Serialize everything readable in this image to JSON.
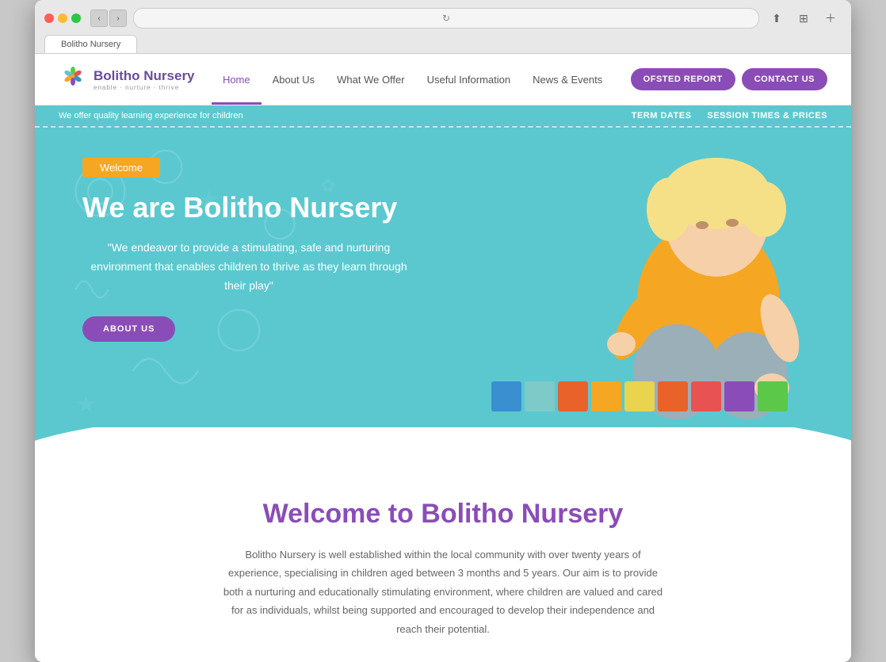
{
  "browser": {
    "tab_label": "Bolitho Nursery"
  },
  "header": {
    "logo_name": "Bolitho Nursery",
    "logo_tagline": "enable · nurture · thrive",
    "nav_items": [
      {
        "label": "Home",
        "active": true
      },
      {
        "label": "About Us",
        "active": false
      },
      {
        "label": "What We Offer",
        "active": false
      },
      {
        "label": "Useful Information",
        "active": false
      },
      {
        "label": "News & Events",
        "active": false
      }
    ],
    "btn_ofsted": "OFSTED REPORT",
    "btn_contact": "CONTACT US"
  },
  "info_bar": {
    "text": "We offer quality learning experience for children",
    "links": [
      "TERM DATES",
      "SESSION TIMES & PRICES"
    ]
  },
  "hero": {
    "welcome_badge": "Welcome",
    "title": "We are Bolitho Nursery",
    "quote": "\"We endeavor to provide a stimulating, safe and nurturing environment that enables children to thrive as they learn through their play\"",
    "btn_label": "ABOUT US"
  },
  "welcome_section": {
    "title": "Welcome to Bolitho Nursery",
    "body": "Bolitho Nursery is well established within the local community with over twenty years of experience, specialising in children aged between 3 months and 5 years. Our aim is to provide both a nurturing and educationally stimulating environment, where children are valued and cared for as individuals, whilst being supported and encouraged to develop their independence and reach their potential."
  },
  "blocks": [
    {
      "color": "#3a8fd1"
    },
    {
      "color": "#7ecac8"
    },
    {
      "color": "#e8622a"
    },
    {
      "color": "#f5a623"
    },
    {
      "color": "#e8d44d"
    },
    {
      "color": "#e8622a"
    },
    {
      "color": "#e85252"
    },
    {
      "color": "#8a4db8"
    },
    {
      "color": "#5bc84a"
    }
  ],
  "colors": {
    "teal": "#5bc8d0",
    "purple": "#8a4db8",
    "orange": "#f5a623"
  }
}
